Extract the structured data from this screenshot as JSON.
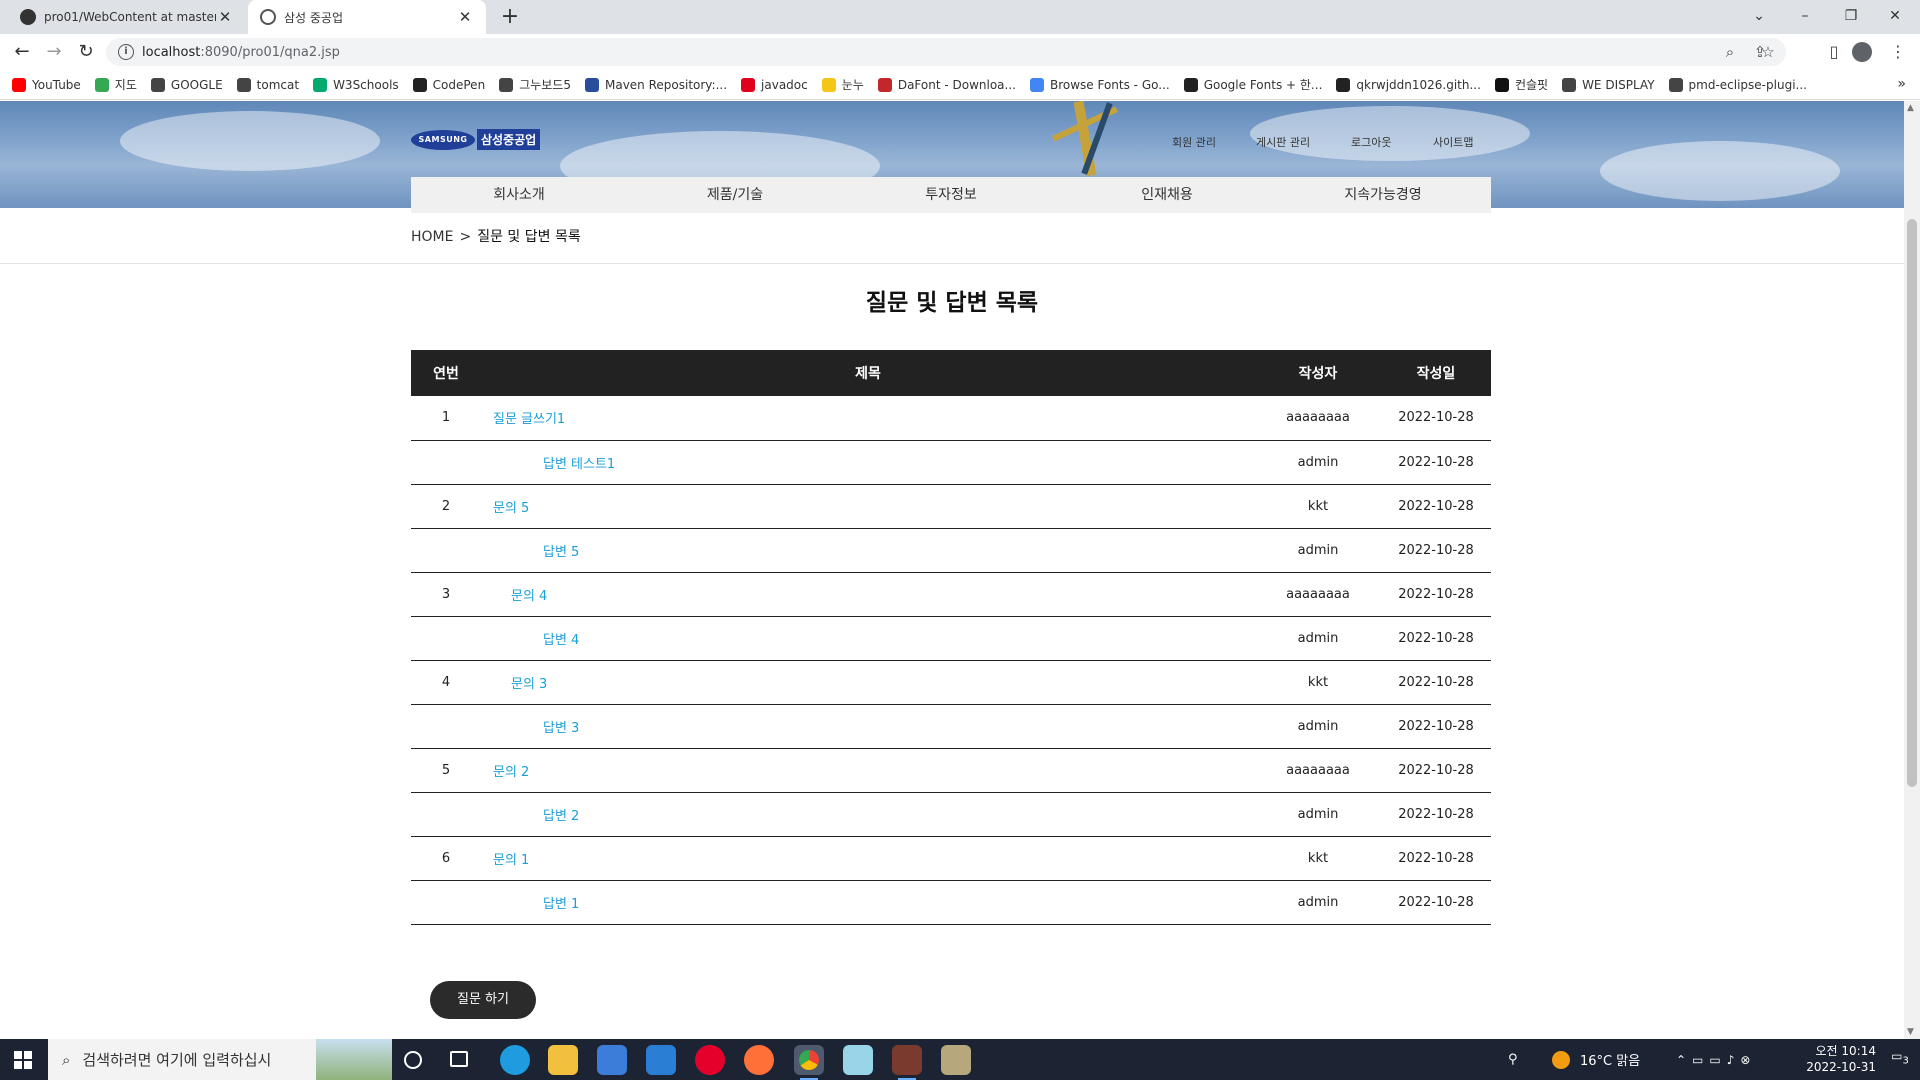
{
  "browser": {
    "tabs": [
      {
        "title": "pro01/WebContent at master · ",
        "active": false
      },
      {
        "title": "삼성 중공업",
        "active": true
      }
    ],
    "url_host": "localhost",
    "url_path": ":8090/pro01/qna2.jsp",
    "bookmarks": [
      {
        "label": "YouTube",
        "color": "#ff0000"
      },
      {
        "label": "지도",
        "color": "#34a853"
      },
      {
        "label": "GOOGLE",
        "color": "#444444"
      },
      {
        "label": "tomcat",
        "color": "#444444"
      },
      {
        "label": "W3Schools",
        "color": "#04aa6d"
      },
      {
        "label": "CodePen",
        "color": "#222222"
      },
      {
        "label": "그누보드5",
        "color": "#444444"
      },
      {
        "label": "Maven Repository:...",
        "color": "#2a4d9b"
      },
      {
        "label": "javadoc",
        "color": "#e0001b"
      },
      {
        "label": "눈누",
        "color": "#f5c518"
      },
      {
        "label": "DaFont - Downloa...",
        "color": "#c0282d"
      },
      {
        "label": "Browse Fonts - Go...",
        "color": "#4285f4"
      },
      {
        "label": "Google Fonts + 한...",
        "color": "#222222"
      },
      {
        "label": "qkrwjddn1026.gith...",
        "color": "#222222"
      },
      {
        "label": "컨슬핏",
        "color": "#111111"
      },
      {
        "label": "WE DISPLAY",
        "color": "#444444"
      },
      {
        "label": "pmd-eclipse-plugi...",
        "color": "#444444"
      }
    ]
  },
  "site": {
    "logo_mark": "SAMSUNG",
    "logo_name": "삼성중공업",
    "util_links": [
      "회원 관리",
      "게시판 관리",
      "로그아웃",
      "사이트맵"
    ],
    "gnb": [
      "회사소개",
      "제품/기술",
      "투자정보",
      "인재채용",
      "지속가능경영"
    ],
    "breadcrumb": {
      "home": "HOME",
      "sep": ">",
      "current": "질문 및 답변 목록"
    },
    "page_title": "질문 및 답변 목록",
    "table": {
      "headers": {
        "no": "연번",
        "title": "제목",
        "writer": "작성자",
        "date": "작성일"
      },
      "rows": [
        {
          "no": "1",
          "title": "질문 글쓰기1",
          "writer": "aaaaaaaa",
          "date": "2022-10-28",
          "indent": 0
        },
        {
          "no": "",
          "title": "답변 테스트1",
          "writer": "admin",
          "date": "2022-10-28",
          "indent": 2
        },
        {
          "no": "2",
          "title": "문의 5",
          "writer": "kkt",
          "date": "2022-10-28",
          "indent": 0
        },
        {
          "no": "",
          "title": "답변 5",
          "writer": "admin",
          "date": "2022-10-28",
          "indent": 2
        },
        {
          "no": "3",
          "title": "문의 4",
          "writer": "aaaaaaaa",
          "date": "2022-10-28",
          "indent": 1
        },
        {
          "no": "",
          "title": "답변 4",
          "writer": "admin",
          "date": "2022-10-28",
          "indent": 2
        },
        {
          "no": "4",
          "title": "문의 3",
          "writer": "kkt",
          "date": "2022-10-28",
          "indent": 1
        },
        {
          "no": "",
          "title": "답변 3",
          "writer": "admin",
          "date": "2022-10-28",
          "indent": 2
        },
        {
          "no": "5",
          "title": "문의 2",
          "writer": "aaaaaaaa",
          "date": "2022-10-28",
          "indent": 0
        },
        {
          "no": "",
          "title": "답변 2",
          "writer": "admin",
          "date": "2022-10-28",
          "indent": 2
        },
        {
          "no": "6",
          "title": "문의 1",
          "writer": "kkt",
          "date": "2022-10-28",
          "indent": 0
        },
        {
          "no": "",
          "title": "답변 1",
          "writer": "admin",
          "date": "2022-10-28",
          "indent": 2
        }
      ]
    },
    "ask_button": "질문 하기",
    "link_color": "#1a9ed6"
  },
  "taskbar": {
    "search_placeholder": "검색하려면 여기에 입력하십시",
    "weather": "16°C  맑음",
    "time": "오전 10:14",
    "date": "2022-10-31",
    "notif_count": "3"
  }
}
